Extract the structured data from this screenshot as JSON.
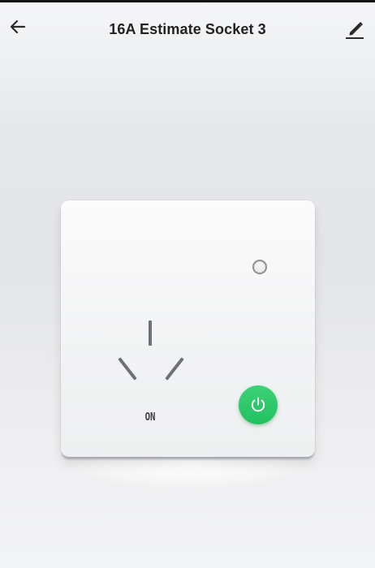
{
  "header": {
    "title": "16A Estimate Socket 3",
    "back_icon": "arrow-left-icon",
    "edit_icon": "pencil-edit-icon"
  },
  "socket": {
    "status_label": "ON",
    "power_on": true,
    "power_icon": "power-icon",
    "indicator_icon": "indicator-led-icon",
    "colors": {
      "power_button": "#2ac766",
      "plate": "#f4f5f6",
      "slots": "#6e7175"
    }
  }
}
